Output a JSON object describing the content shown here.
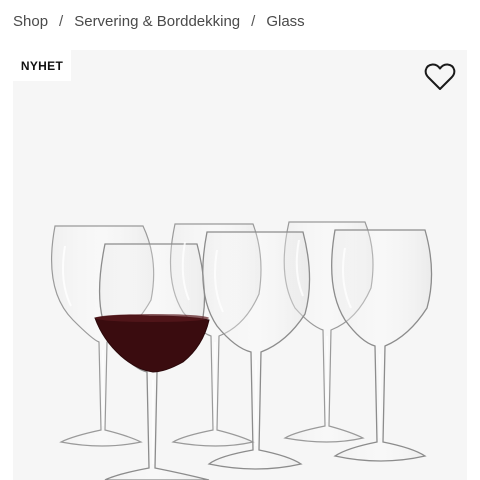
{
  "breadcrumb": {
    "items": [
      "Shop",
      "Servering & Borddekking",
      "Glass"
    ],
    "separator": "/"
  },
  "product": {
    "badge": "NYHET",
    "wishlist_icon": "heart-outline-icon",
    "image_subject": "six-wine-glasses",
    "colors": {
      "background": "#f6f6f6",
      "wine": "#3a0c0f",
      "glass_stroke": "#9a9a9a"
    }
  }
}
